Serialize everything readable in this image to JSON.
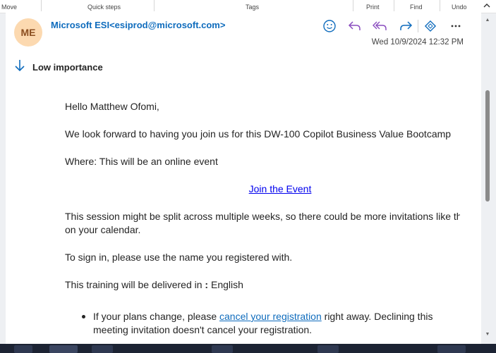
{
  "ribbon": {
    "groups": [
      "Move",
      "Quick steps",
      "Tags",
      "Print",
      "Find",
      "Undo"
    ]
  },
  "message": {
    "avatar_initials": "ME",
    "sender": "Microsoft ESI<esiprod@microsoft.com>",
    "date": "Wed 10/9/2024 12:32 PM",
    "importance": "Low importance",
    "actions": [
      "smile-icon",
      "reply-icon",
      "reply-all-icon",
      "forward-icon",
      "apps-icon",
      "more-icon"
    ]
  },
  "body": {
    "greeting": "Hello Matthew Ofomi,",
    "intro": "We look forward to having you join us for this DW-100 Copilot Business Value Bootcamp",
    "where": "Where: This will be an online event",
    "join_link": "Join the Event",
    "session_line1": "This session might be split across multiple weeks, so there could be more invitations like this",
    "session_line2": "on your calendar.",
    "signin": "To sign in, please use the name you registered with.",
    "training_prefix": "This training will be delivered in",
    "training_colon": " : ",
    "training_language": "English",
    "bullet_prefix": "If your plans change, please ",
    "bullet_link": "cancel your registration",
    "bullet_suffix": " right away. Declining this",
    "bullet_line2": "meeting invitation doesn't cancel your registration."
  },
  "colors": {
    "accent": "#0f6cbd",
    "avatar_bg": "#fcd9b0",
    "reply_purple": "#8a4dbf"
  }
}
